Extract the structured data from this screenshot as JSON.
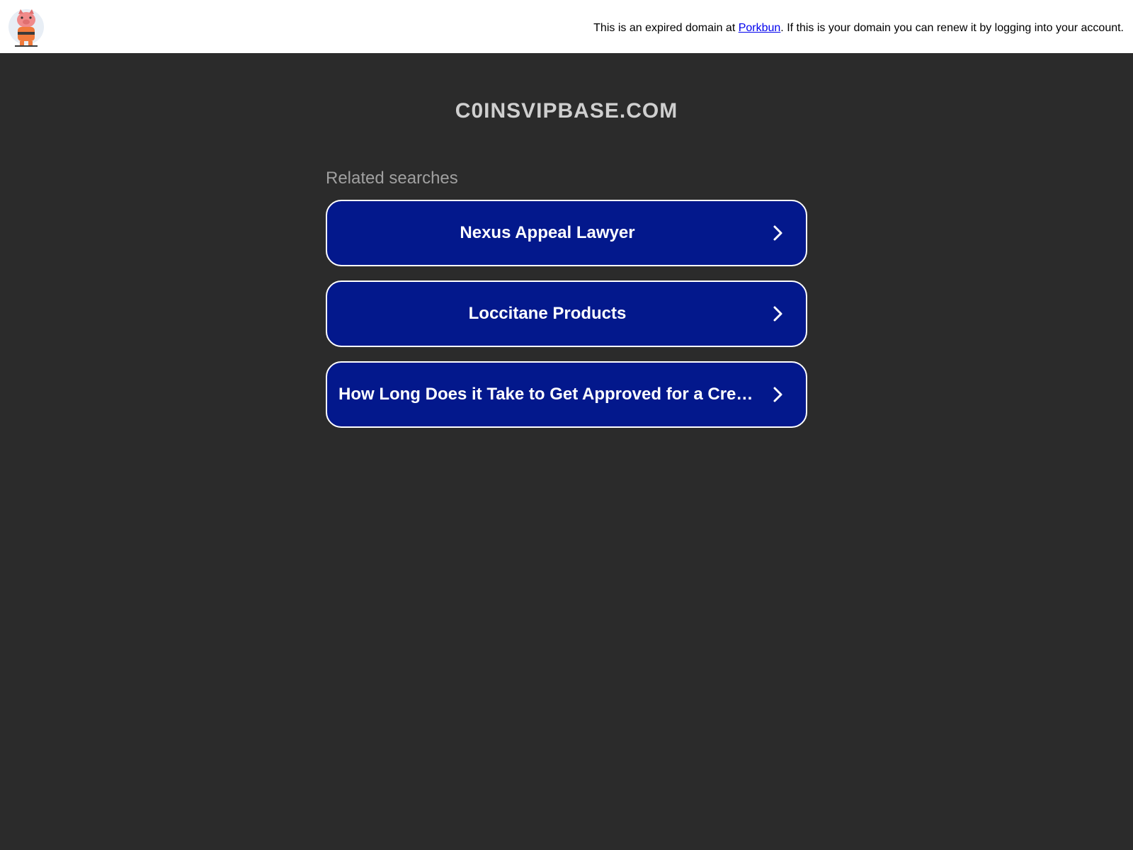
{
  "header": {
    "notice_prefix": "This is an expired domain at ",
    "notice_link": "Porkbun",
    "notice_suffix": ". If this is your domain you can renew it by logging into your account.",
    "logo_icon": "porkbun-pig-logo-icon"
  },
  "main": {
    "domain": "C0INSVIPBASE.COM",
    "related_label": "Related searches",
    "searches": [
      {
        "label": "Nexus Appeal Lawyer"
      },
      {
        "label": "Loccitane Products"
      },
      {
        "label": "How Long Does it Take to Get Approved for a Credit Card"
      }
    ],
    "chevron_icon": "chevron-right-icon"
  },
  "colors": {
    "background": "#2b2b2b",
    "button": "#03188c",
    "link": "#0000ee"
  }
}
